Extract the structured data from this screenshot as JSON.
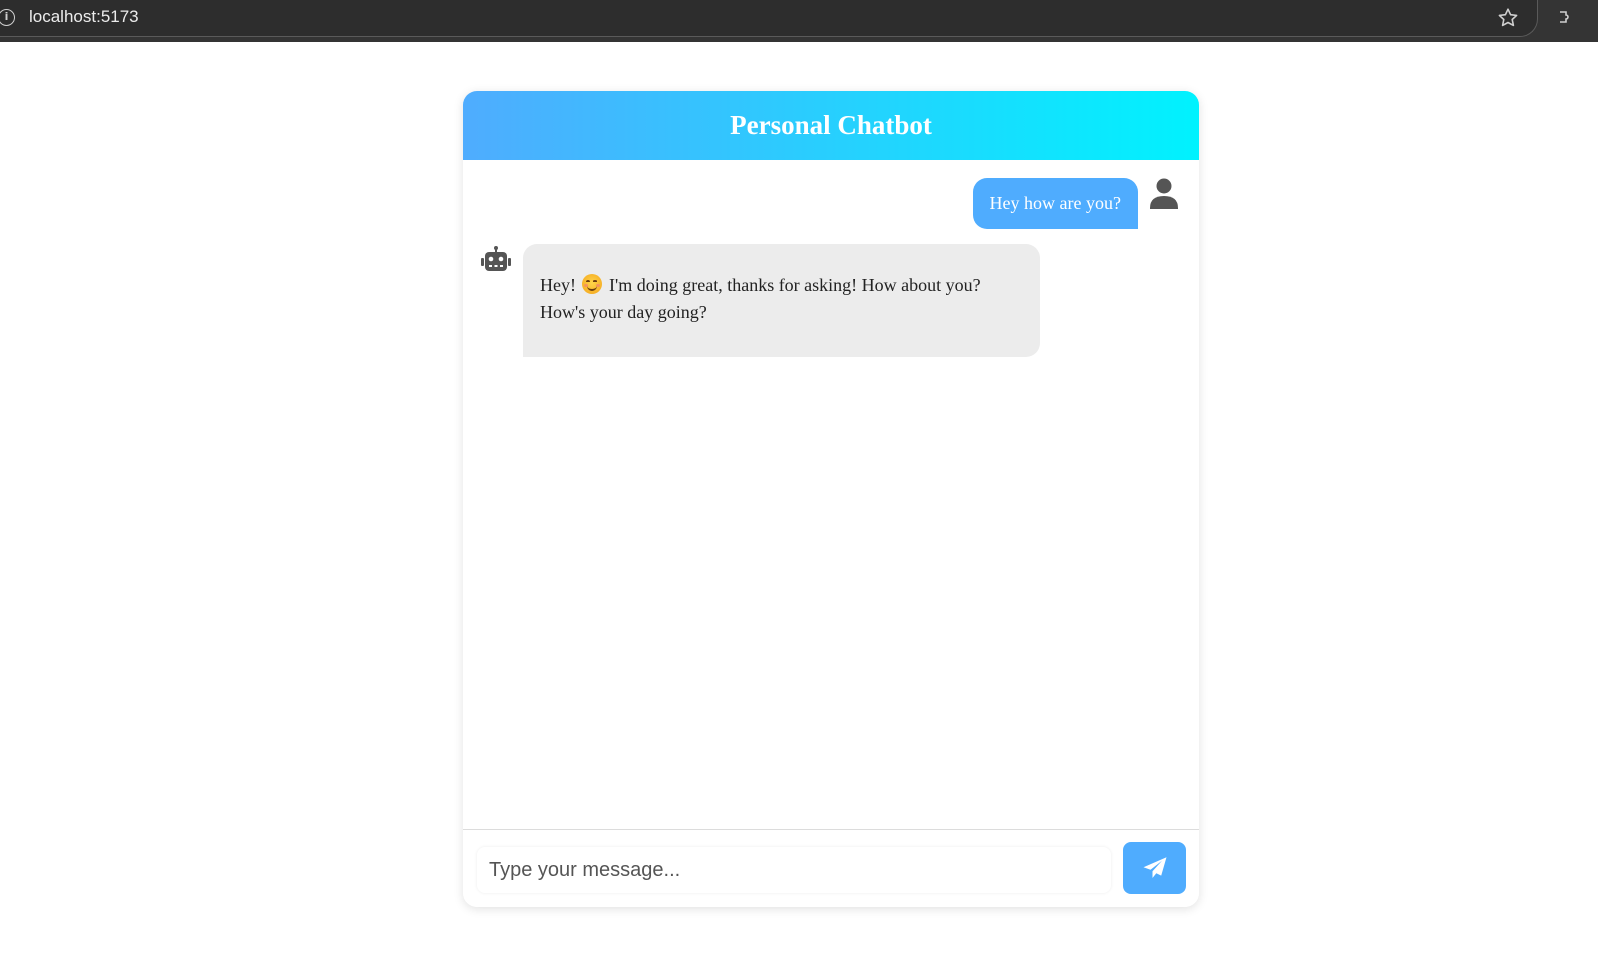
{
  "browser": {
    "url": "localhost:5173",
    "icons": [
      "info-icon",
      "star-icon",
      "extension-icon"
    ]
  },
  "chat": {
    "title": "Personal Chatbot",
    "header_gradient": [
      "#4facfe",
      "#00f2fe"
    ],
    "messages": [
      {
        "sender": "user",
        "text": "Hey how are you?",
        "avatar_icon": "user-icon"
      },
      {
        "sender": "bot",
        "text_before_emoji": "Hey! ",
        "emoji": "smiling-face-emoji",
        "text_after_emoji": " I'm doing great, thanks for asking! How about you? How's your day going?",
        "avatar_icon": "robot-icon"
      }
    ],
    "input": {
      "placeholder": "Type your message...",
      "value": ""
    },
    "send_button_icon": "paper-plane-icon",
    "colors": {
      "accent": "#4facfe",
      "bot_bubble": "#ececec"
    }
  }
}
